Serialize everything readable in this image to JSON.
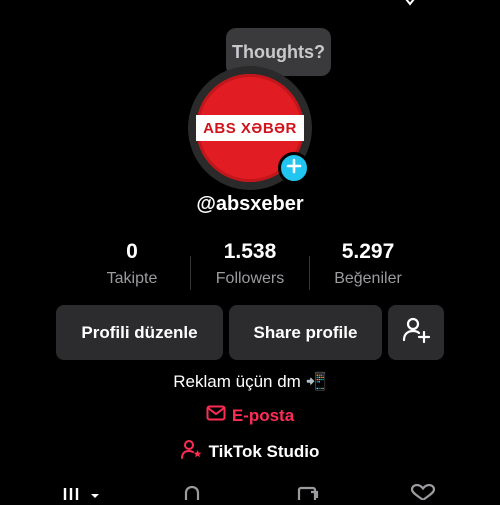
{
  "profile": {
    "thoughts_bubble": "Thoughts?",
    "avatar_text": "ABS XƏBƏR",
    "username": "@absxeber",
    "stats": [
      {
        "value": "0",
        "label": "Takipte"
      },
      {
        "value": "1.538",
        "label": "Followers"
      },
      {
        "value": "5.297",
        "label": "Beğeniler"
      }
    ],
    "buttons": {
      "edit": "Profili düzenle",
      "share": "Share profile"
    },
    "bio": "Reklam üçün dm 📲",
    "email_label": "E-posta",
    "studio_label": "TikTok Studio"
  },
  "colors": {
    "background": "#000000",
    "accent_red": "#fe2c55",
    "plus_blue": "#20c5f0",
    "button_bg": "#2c2c2e",
    "muted_text": "#9b9ba0"
  },
  "icons": [
    "plus-icon",
    "add-friend-icon",
    "mail-icon",
    "person-star-icon",
    "grid-icon",
    "lock-icon",
    "repost-icon",
    "heart-icon"
  ]
}
